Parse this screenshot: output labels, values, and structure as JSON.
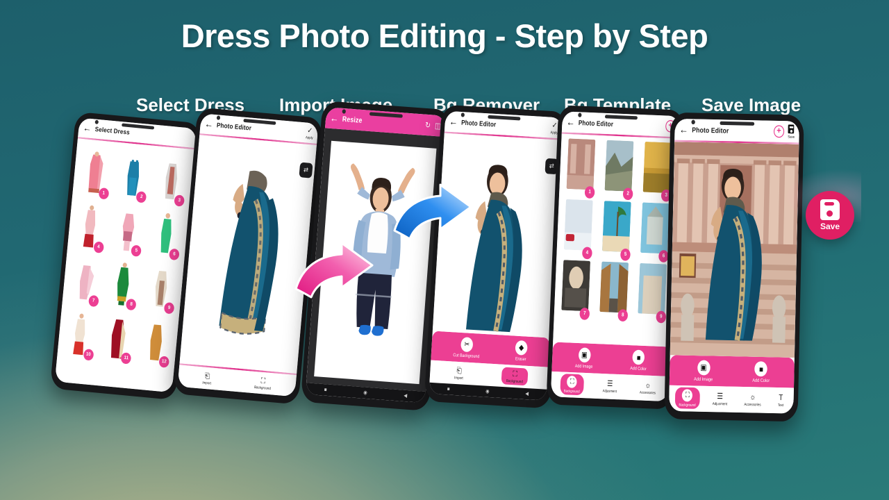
{
  "title": "Dress Photo Editing - Step by Step",
  "colors": {
    "accent_pink": "#ec3f93",
    "deep_pink": "#e01f63",
    "bg_teal": "#216872",
    "bg_khaki": "#cec18c"
  },
  "steps": [
    {
      "label": "Select Dress"
    },
    {
      "label": "Import Image"
    },
    {
      "label": "Bg Remover"
    },
    {
      "label": "Bg Template"
    },
    {
      "label": "Save Image"
    }
  ],
  "phones": [
    {
      "id": "phone-select-dress",
      "appbar": {
        "back_icon": "back-arrow-icon",
        "title": "Select Dress"
      },
      "grid_badges": [
        "1",
        "2",
        "3",
        "4",
        "5",
        "6",
        "7",
        "8",
        "9",
        "10",
        "11",
        "12"
      ]
    },
    {
      "id": "phone-import-image",
      "appbar": {
        "back_icon": "back-arrow-icon",
        "title": "Photo Editor",
        "apply_icon": "check-icon",
        "apply_label": "Apply"
      },
      "tool_chip": "flip-icon",
      "bottom": [
        {
          "icon": "import-icon",
          "label": "Import",
          "active": false
        },
        {
          "icon": "background-icon",
          "label": "Background",
          "active": false
        }
      ]
    },
    {
      "id": "phone-resize",
      "appbar": {
        "back_icon": "back-arrow-icon",
        "title": "Resize",
        "rotate_icon": "rotate-icon",
        "flip_icon": "flip-horizontal-icon"
      },
      "navbar": [
        "square-icon",
        "circle-icon",
        "triangle-icon"
      ]
    },
    {
      "id": "phone-bg-remover",
      "appbar": {
        "back_icon": "back-arrow-icon",
        "title": "Photo Editor",
        "apply_icon": "check-icon",
        "apply_label": "Apply"
      },
      "tool_chip": "flip-icon",
      "panel": [
        {
          "icon": "scissors-icon",
          "label": "Cut Background"
        },
        {
          "icon": "eraser-icon",
          "label": "Eraser"
        }
      ],
      "bottom": [
        {
          "icon": "import-icon",
          "label": "Import",
          "active": false
        },
        {
          "icon": "background-icon",
          "label": "Background",
          "active": true
        }
      ],
      "navbar": [
        "square-icon",
        "circle-icon",
        "triangle-icon"
      ]
    },
    {
      "id": "phone-bg-template",
      "appbar": {
        "back_icon": "back-arrow-icon",
        "title": "Photo Editor",
        "add_icon": "add-circle-icon"
      },
      "grid_badges": [
        "1",
        "2",
        "3",
        "4",
        "5",
        "6",
        "7",
        "8",
        "9"
      ],
      "panel": [
        {
          "icon": "add-image-icon",
          "label": "Add Image"
        },
        {
          "icon": "add-color-icon",
          "label": "Add Color"
        }
      ],
      "tabs": [
        {
          "icon": "background-icon",
          "label": "Background",
          "active": true
        },
        {
          "icon": "adjustment-icon",
          "label": "Adjusment",
          "active": false
        },
        {
          "icon": "accessories-icon",
          "label": "Accessories",
          "active": false
        }
      ]
    },
    {
      "id": "phone-save-image",
      "appbar": {
        "back_icon": "back-arrow-icon",
        "title": "Photo Editor",
        "add_icon": "add-circle-icon",
        "save_icon": "save-icon",
        "save_label": "Save"
      },
      "panel": [
        {
          "icon": "add-image-icon",
          "label": "Add Image"
        },
        {
          "icon": "add-color-icon",
          "label": "Add Color"
        }
      ],
      "tabs": [
        {
          "icon": "background-icon",
          "label": "Background",
          "active": true
        },
        {
          "icon": "adjustment-icon",
          "label": "Adjusment",
          "active": false
        },
        {
          "icon": "accessories-icon",
          "label": "Accessories",
          "active": false
        },
        {
          "icon": "text-icon",
          "label": "Text",
          "active": false
        }
      ]
    }
  ],
  "save_badge": {
    "icon": "save-floppy-icon",
    "label": "Save"
  },
  "arrows": [
    {
      "name": "pink-arrow",
      "color": "#ec2a86"
    },
    {
      "name": "blue-arrow",
      "color": "#1f7fe0"
    }
  ]
}
